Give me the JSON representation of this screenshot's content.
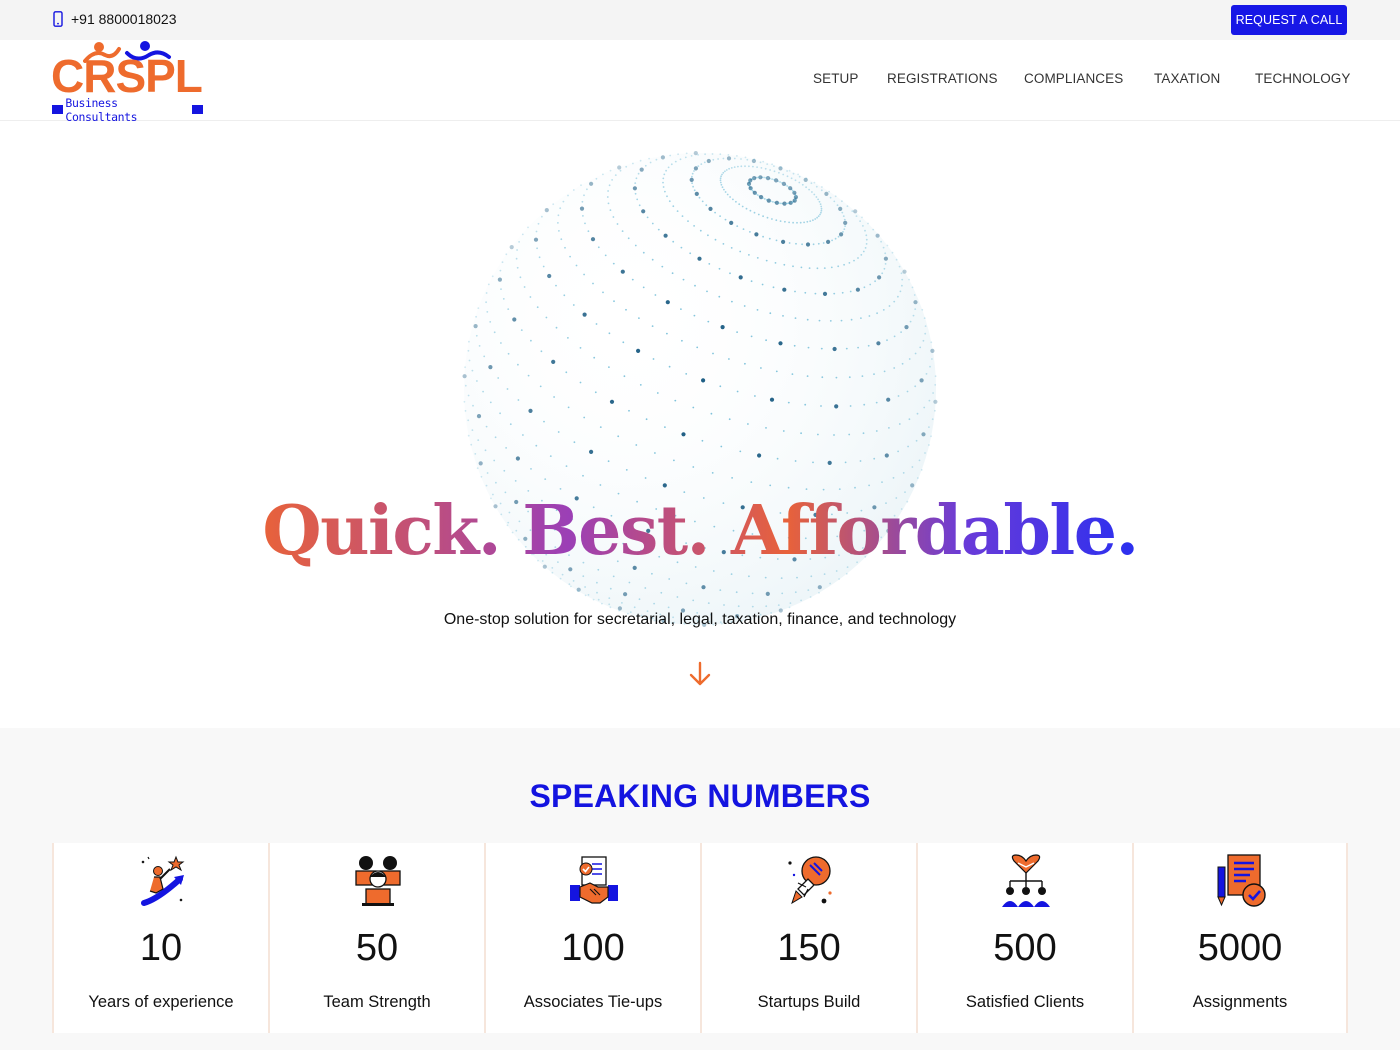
{
  "topbar": {
    "phone": "+91 8800018023",
    "request_button": "REQUEST A CALL"
  },
  "logo": {
    "name": "CRSPL",
    "subtitle": "Business Consultants"
  },
  "nav": [
    "SETUP",
    "REGISTRATIONS",
    "COMPLIANCES",
    "TAXATION",
    "TECHNOLOGY"
  ],
  "hero": {
    "headline": "Quick. Best. Affordable.",
    "tagline": "One-stop solution for secretarial, legal, taxation, finance, and technology"
  },
  "numbers": {
    "title": "SPEAKING NUMBERS",
    "stats": [
      {
        "value": "10",
        "label": "Years of experience",
        "icon": "growth-icon"
      },
      {
        "value": "50",
        "label": "Team Strength",
        "icon": "team-icon"
      },
      {
        "value": "100",
        "label": "Associates Tie-ups",
        "icon": "handshake-icon"
      },
      {
        "value": "150",
        "label": "Startups Build",
        "icon": "rocket-icon"
      },
      {
        "value": "500",
        "label": "Satisfied Clients",
        "icon": "clients-icon"
      },
      {
        "value": "5000",
        "label": "Assignments",
        "icon": "assignment-icon"
      }
    ]
  },
  "colors": {
    "brand_orange": "#ee6b2d",
    "brand_blue": "#1414e0",
    "topbar_bg": "#f4f4f4",
    "section_bg": "#f8f8f8"
  }
}
